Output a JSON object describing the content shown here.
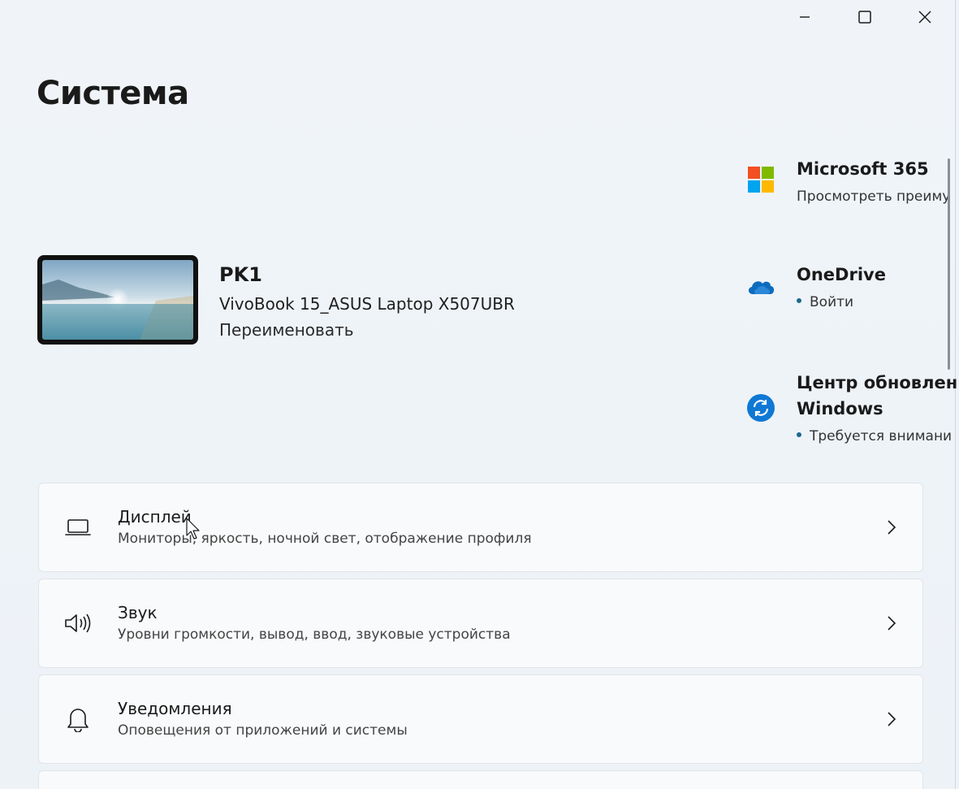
{
  "window": {
    "controls": {
      "minimize_icon": "minimize-icon",
      "maximize_icon": "maximize-icon",
      "close_icon": "close-icon"
    }
  },
  "page": {
    "title": "Система"
  },
  "device": {
    "name": "PK1",
    "model": "VivoBook 15_ASUS Laptop X507UBR",
    "rename_label": "Переименовать"
  },
  "quick_links": [
    {
      "title": "Microsoft 365",
      "subtitle": "Просмотреть преиму",
      "icon": "microsoft-logo-icon"
    },
    {
      "title": "OneDrive",
      "subtitle": "Войти",
      "icon": "onedrive-cloud-icon"
    },
    {
      "title": "Центр обновления",
      "title2": "Windows",
      "subtitle": "Требуется внимани",
      "icon": "windows-update-icon"
    }
  ],
  "settings": [
    {
      "title": "Дисплей",
      "description": "Мониторы, яркость, ночной свет, отображение профиля",
      "icon": "laptop-display-icon"
    },
    {
      "title": "Звук",
      "description": "Уровни громкости, вывод, ввод, звуковые устройства",
      "icon": "speaker-icon"
    },
    {
      "title": "Уведомления",
      "description": "Оповещения от приложений и системы",
      "icon": "bell-icon"
    }
  ],
  "colors": {
    "background": "#eef3f9",
    "accent": "#1c6a8c",
    "onedrive": "#0f6cbd",
    "update": "#0f78d4"
  }
}
